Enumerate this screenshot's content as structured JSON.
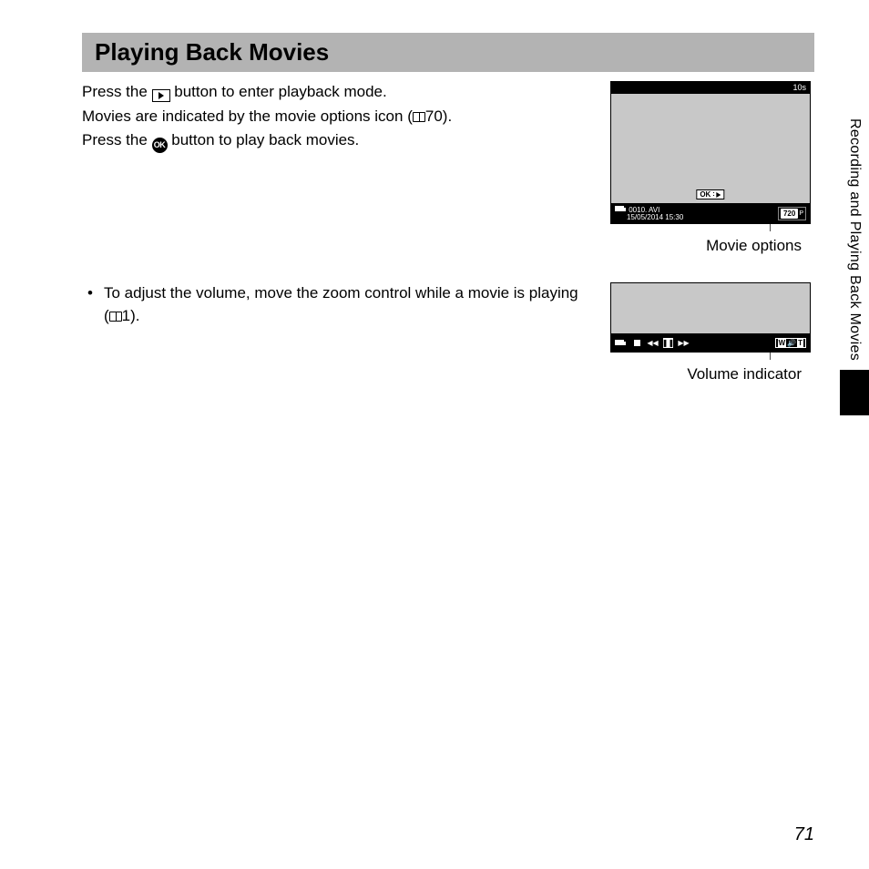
{
  "title": "Playing Back Movies",
  "body": {
    "p1a": "Press the ",
    "p1b": " button to enter playback mode.",
    "p2a": "Movies are indicated by the movie options icon (",
    "p2_ref": "70",
    "p2b": ").",
    "p3a": "Press the ",
    "p3b": " button to play back movies.",
    "bullet_a": "To adjust the volume, move the zoom control while a movie is playing (",
    "bullet_ref": "1",
    "bullet_b": ")."
  },
  "screen1": {
    "duration": "10s",
    "ok_label": "OK",
    "file": "0010. AVI",
    "datetime": "15/05/2014  15:30",
    "resolution": "720",
    "res_suffix": "P",
    "caption": "Movie options"
  },
  "screen2": {
    "vol_w": "W",
    "vol_t": "T",
    "caption": "Volume indicator"
  },
  "side_label": "Recording and Playing Back Movies",
  "page_number": "71"
}
